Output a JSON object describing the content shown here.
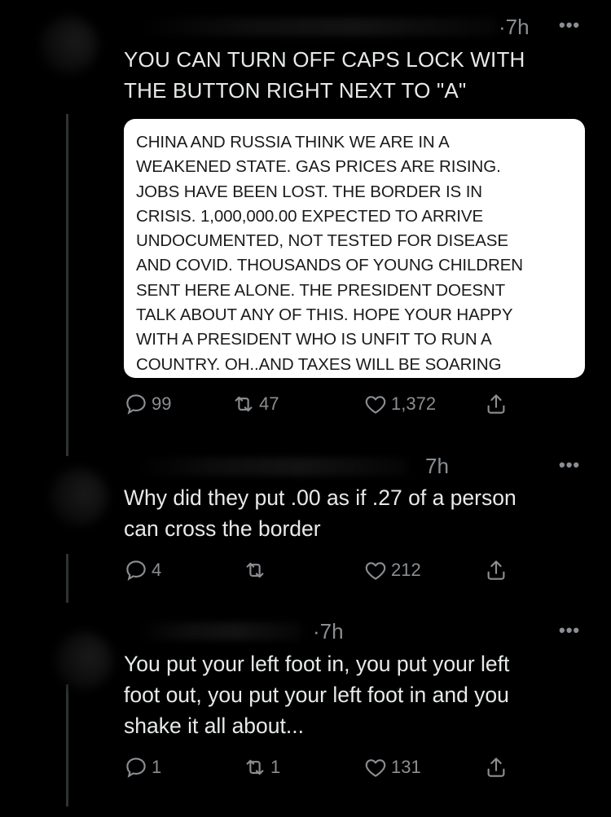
{
  "colors": {
    "background": "#000000",
    "text": "#e7e9ea",
    "muted": "#8b8f93",
    "card": "#ffffff",
    "card_text": "#1a1a1a"
  },
  "tweets": [
    {
      "time": "·7h",
      "text": "YOU CAN TURN OFF CAPS LOCK WITH\nTHE BUTTON RIGHT NEXT TO \"A\"",
      "quote_card": {
        "text": "CHINA AND RUSSIA THINK WE ARE IN A\nWEAKENED STATE. GAS PRICES ARE RISING.\nJOBS HAVE BEEN LOST. THE BORDER IS IN\nCRISIS. 1,000,000.00 EXPECTED TO ARRIVE\nUNDOCUMENTED, NOT TESTED FOR DISEASE\nAND COVID. THOUSANDS OF YOUNG CHILDREN\nSENT HERE ALONE. THE PRESIDENT DOESNT\nTALK ABOUT ANY OF THIS. HOPE YOUR HAPPY\nWITH A PRESIDENT WHO IS UNFIT TO RUN A\nCOUNTRY. OH..AND TAXES WILL BE SOARING"
      },
      "replies": "99",
      "retweets": "47",
      "likes": "1,372"
    },
    {
      "time": "7h",
      "text": "Why did they put .00 as if .27 of a person\ncan cross the border",
      "replies": "4",
      "retweets": "",
      "likes": "212"
    },
    {
      "time": "·7h",
      "text": "You put your left foot in, you put your left\nfoot out, you put your left foot in and you\nshake it all about...",
      "replies": "1",
      "retweets": "1",
      "likes": "131"
    }
  ],
  "icons": {
    "more": "more-horizontal-icon",
    "reply": "reply-bubble-icon",
    "retweet": "retweet-arrows-icon",
    "like": "heart-icon",
    "share": "share-upload-icon"
  }
}
